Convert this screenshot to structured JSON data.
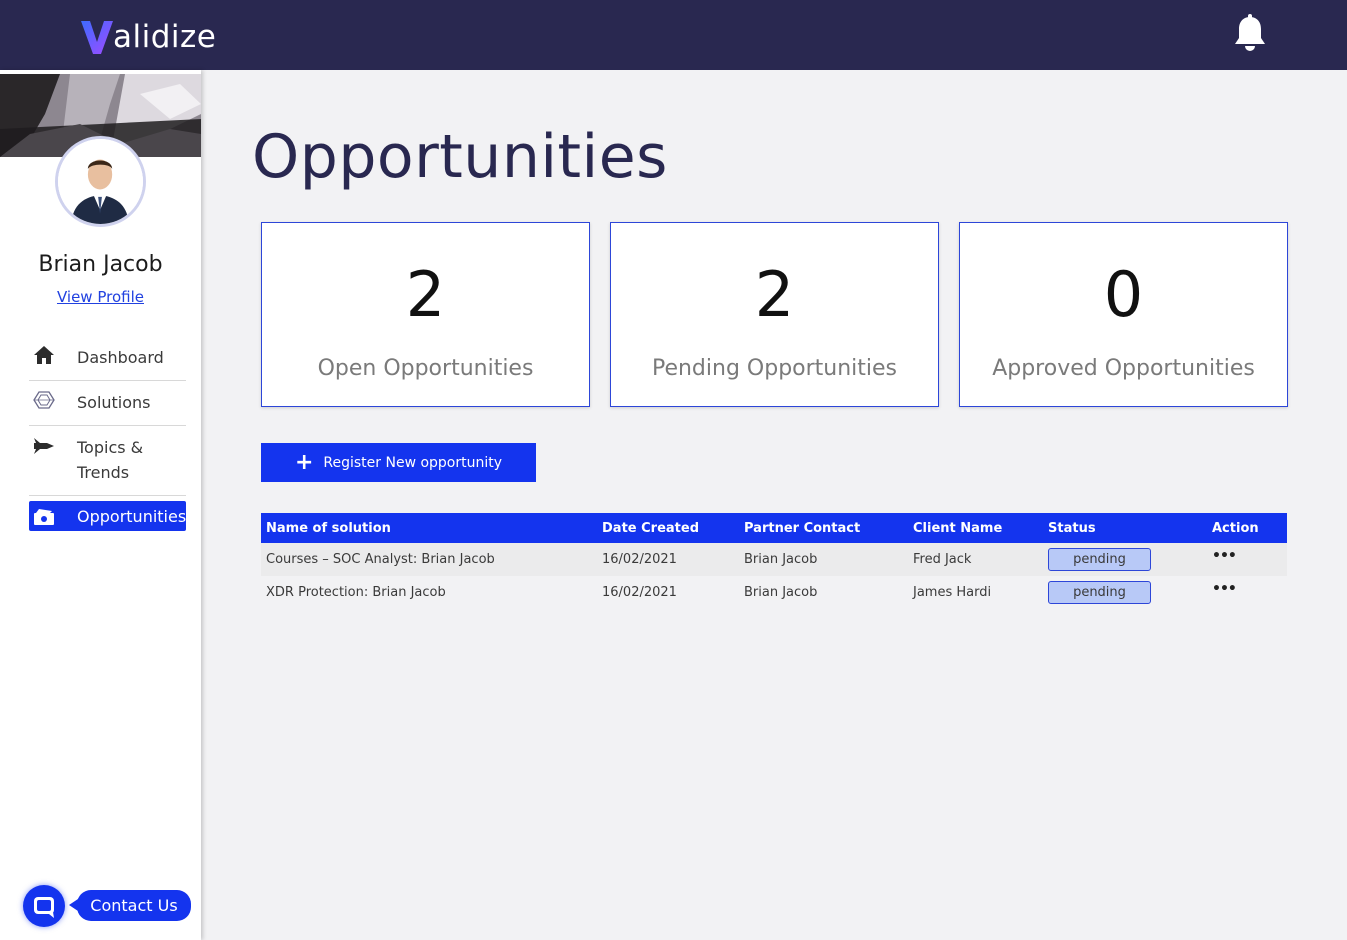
{
  "app": {
    "logo_text": "alidize",
    "brand_colors": {
      "navbar": "#292850",
      "accent": "#1434ee",
      "status_pill": "#b8c9f7"
    }
  },
  "icons": {
    "logo": "validize-v-logo-icon",
    "notification": "bell-icon",
    "chat": "chat-bubble-icon"
  },
  "profile": {
    "name": "Brian Jacob",
    "view_profile_label": "View Profile"
  },
  "sidebar": {
    "items": [
      {
        "label": "Dashboard",
        "icon": "home-icon",
        "active": false
      },
      {
        "label": "Solutions",
        "icon": "hexagon-icon",
        "active": false
      },
      {
        "label": "Topics & Trends",
        "icon": "rocket-icon",
        "active": false
      },
      {
        "label": "Opportunities",
        "icon": "money-icon",
        "active": true
      }
    ]
  },
  "contact": {
    "label": "Contact Us"
  },
  "page": {
    "title": "Opportunities"
  },
  "stats": [
    {
      "value": "2",
      "label": "Open Opportunities"
    },
    {
      "value": "2",
      "label": "Pending Opportunities"
    },
    {
      "value": "0",
      "label": "Approved Opportunities"
    }
  ],
  "register_button": {
    "icon_text": "+",
    "label": "Register New opportunity"
  },
  "table": {
    "headers": {
      "name": "Name of solution",
      "date": "Date Created",
      "partner": "Partner Contact",
      "client": "Client Name",
      "status": "Status",
      "action": "Action"
    },
    "rows": [
      {
        "name": "Courses – SOC Analyst: Brian Jacob",
        "date": "16/02/2021",
        "partner": "Brian Jacob",
        "client": "Fred Jack",
        "status": "pending",
        "action": "•••"
      },
      {
        "name": "XDR Protection: Brian Jacob",
        "date": "16/02/2021",
        "partner": "Brian Jacob",
        "client": "James Hardi",
        "status": "pending",
        "action": "•••"
      }
    ]
  }
}
